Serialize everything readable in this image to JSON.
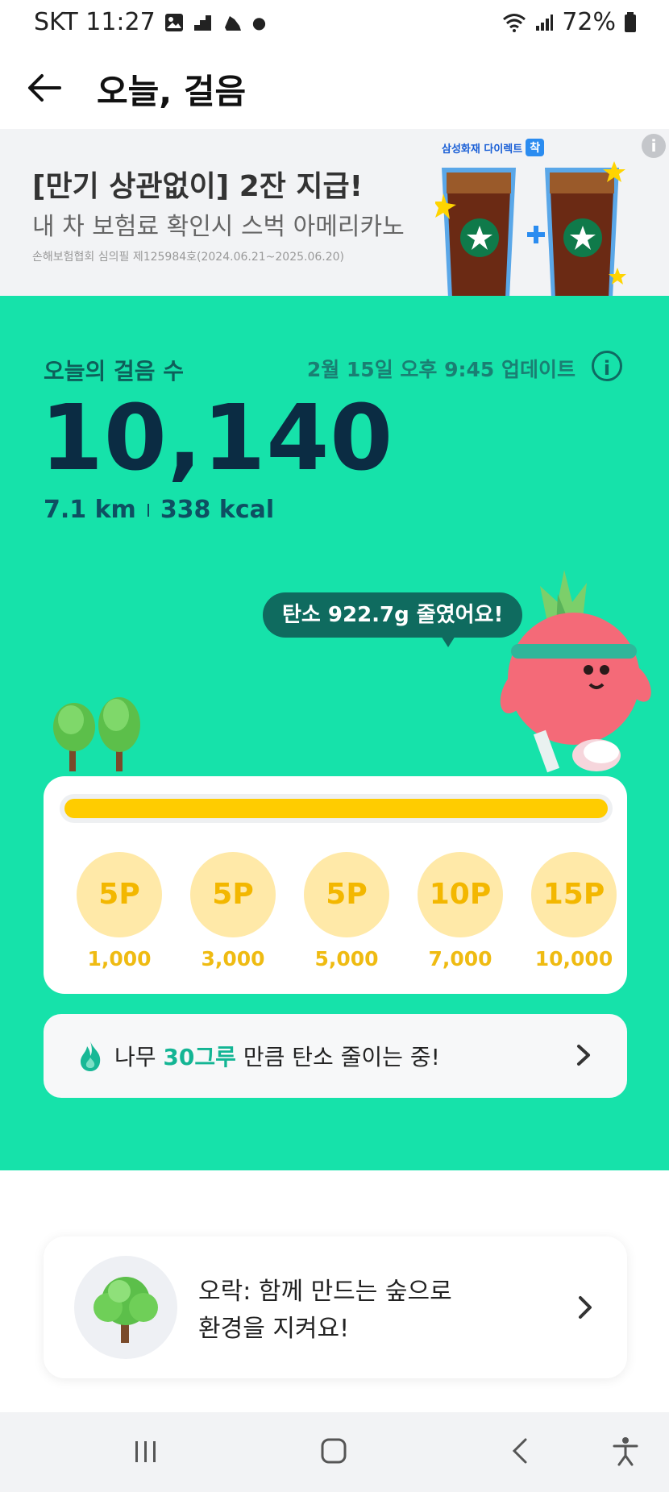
{
  "status_bar": {
    "carrier_time": "SKT 11:27",
    "battery": "72%"
  },
  "header": {
    "title": "오늘, 걸음"
  },
  "banner": {
    "headline": "[만기 상관없이] 2잔 지급!",
    "subline": "내 차 보험료 확인시 스벅 아메리카노",
    "legal": "손해보험협회 심의필 제125984호(2024.06.21~2025.06.20)",
    "brand": "삼성화재 다이렉트",
    "brand_badge": "착"
  },
  "steps": {
    "label": "오늘의 걸음 수",
    "updated": "2월 15일 오후 9:45 업데이트",
    "count": "10,140",
    "distance": "7.1 km",
    "calories": "338 kcal",
    "carbon_message": "탄소 922.7g 줄였어요!",
    "progress": 1.0
  },
  "rewards": [
    {
      "points": "5P",
      "threshold": "1,000"
    },
    {
      "points": "5P",
      "threshold": "3,000"
    },
    {
      "points": "5P",
      "threshold": "5,000"
    },
    {
      "points": "10P",
      "threshold": "7,000"
    },
    {
      "points": "15P",
      "threshold": "10,000"
    }
  ],
  "tree_card": {
    "prefix": "나무 ",
    "count": "30그루",
    "suffix": " 만큼 탄소 줄이는 중!"
  },
  "olak_card": {
    "line1": "오락: 함께 만드는 숲으로",
    "line2": "환경을 지켜요!"
  },
  "colors": {
    "green": "#16e2aa",
    "progress": "#ffcc00",
    "reward_circle": "#ffe9a8",
    "reward_text": "#f3b700"
  }
}
